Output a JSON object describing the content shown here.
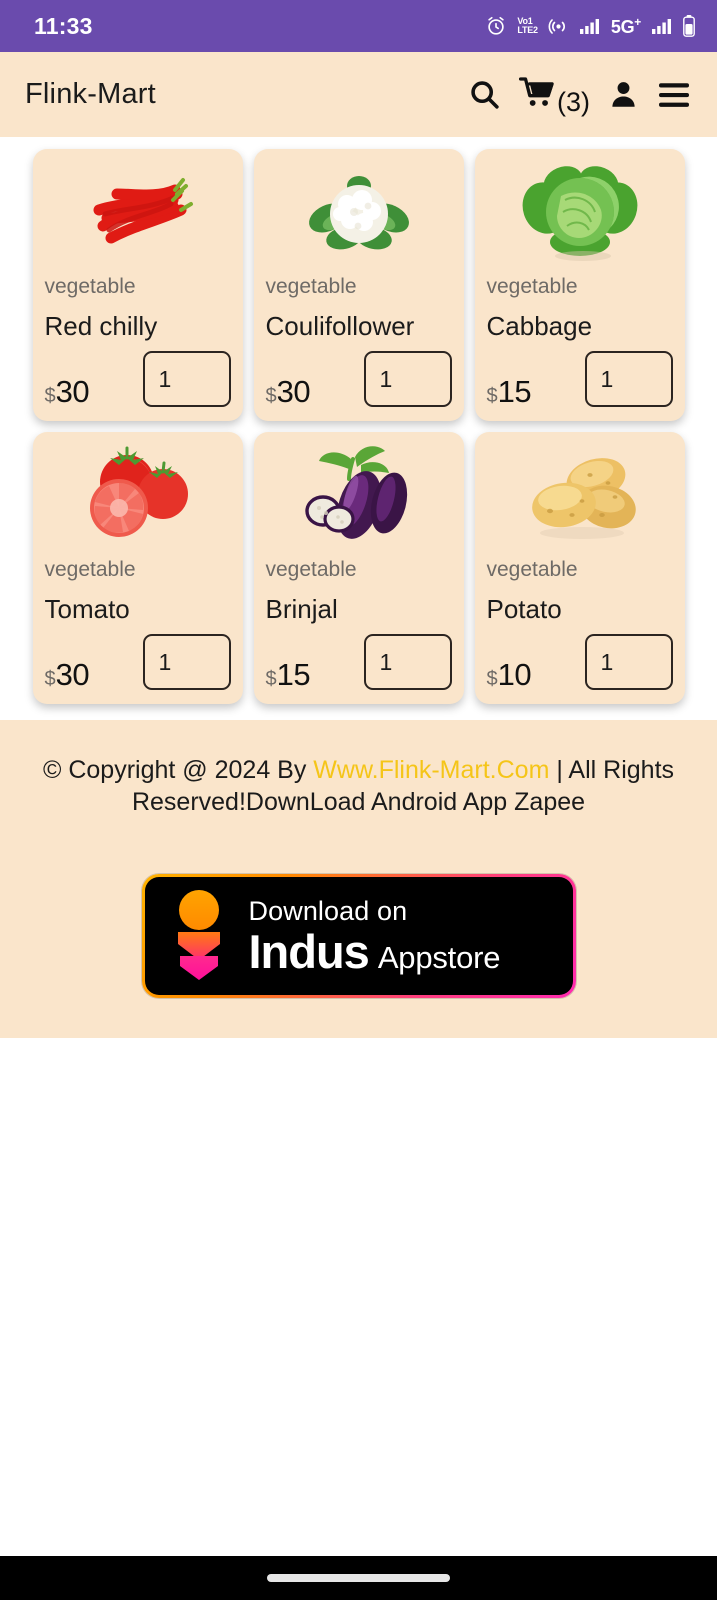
{
  "status_bar": {
    "time": "11:33",
    "icons": [
      "alarm-icon",
      "volte-icon",
      "hotspot-icon",
      "signal-icon",
      "network-5g-label",
      "signal-icon-2",
      "battery-icon"
    ],
    "volte_top": "Vo1",
    "volte_bottom": "LTE2",
    "network": "5G",
    "network_sup": "+",
    "background_color": "#6a4bad"
  },
  "header": {
    "brand": "Flink-Mart",
    "search_label": "search-icon",
    "cart_label": "cart-icon",
    "cart_count": "(3)",
    "account_label": "account-icon",
    "menu_label": "menu-icon",
    "background_color": "#fae5cb"
  },
  "products": [
    {
      "category": "vegetable",
      "name": "Red chilly",
      "currency": "$",
      "price": "30",
      "qty": "1",
      "image": "red-chilly-image"
    },
    {
      "category": "vegetable",
      "name": "Coulifollower",
      "currency": "$",
      "price": "30",
      "qty": "1",
      "image": "cauliflower-image"
    },
    {
      "category": "vegetable",
      "name": "Cabbage",
      "currency": "$",
      "price": "15",
      "qty": "1",
      "image": "cabbage-image"
    },
    {
      "category": "vegetable",
      "name": "Tomato",
      "currency": "$",
      "price": "30",
      "qty": "1",
      "image": "tomato-image"
    },
    {
      "category": "vegetable",
      "name": "Brinjal",
      "currency": "$",
      "price": "15",
      "qty": "1",
      "image": "brinjal-image"
    },
    {
      "category": "vegetable",
      "name": "Potato",
      "currency": "$",
      "price": "10",
      "qty": "1",
      "image": "potato-image"
    }
  ],
  "footer": {
    "copyright_before": "© Copyright @ 2024 By ",
    "site_link": "Www.Flink-Mart.Com",
    "separator": " | ",
    "copyright_after": "All Rights Reserved!DownLoad Android App Zapee",
    "link_color": "#f5c518",
    "badge": {
      "top_text": "Download on",
      "name": "Indus",
      "store": "Appstore"
    }
  },
  "nav_bar": {
    "home_indicator": "home-indicator"
  }
}
